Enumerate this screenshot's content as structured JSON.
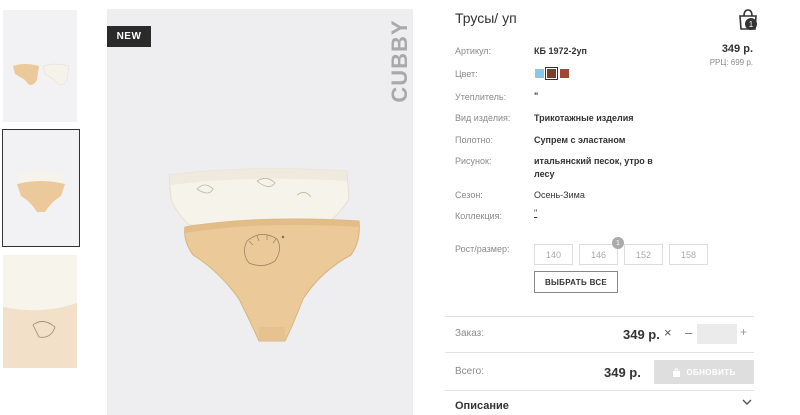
{
  "product": {
    "title": "Трусы/ уп",
    "badge": "NEW",
    "brand": "CUBBY",
    "price": "349 р.",
    "rrc": "РРЦ: 699 р."
  },
  "cart": {
    "count": "1"
  },
  "attributes": [
    {
      "label": "Артикул:",
      "value": "КБ 1972-2уп"
    },
    {
      "label": "Цвет:",
      "value": ""
    },
    {
      "label": "Утеплитель:",
      "value": "\""
    },
    {
      "label": "Вид изделия:",
      "value": "Трикотажные изделия"
    },
    {
      "label": "Полотно:",
      "value": "Супрем с эластаном"
    },
    {
      "label": "Рисунок:",
      "value": "итальянский песок, утро в лесу"
    },
    {
      "label": "Сезон:",
      "value": "Осень-Зима"
    },
    {
      "label": "Коллекция:",
      "value": "\""
    }
  ],
  "colors": [
    "#8ec6e8",
    "#7a3f2c",
    "#9c4a35"
  ],
  "sizes": {
    "label": "Рост/размер:",
    "options": [
      "140",
      "146",
      "152",
      "158"
    ],
    "badge_count": "1",
    "select_all": "ВЫБРАТЬ ВСЕ"
  },
  "order": {
    "order_label": "Заказ:",
    "order_price": "349 р.",
    "times": "×",
    "minus": "–",
    "plus": "+",
    "total_label": "Всего:",
    "total_price": "349 р.",
    "update": "ОБНОВИТЬ"
  },
  "description": {
    "label": "Описание"
  }
}
